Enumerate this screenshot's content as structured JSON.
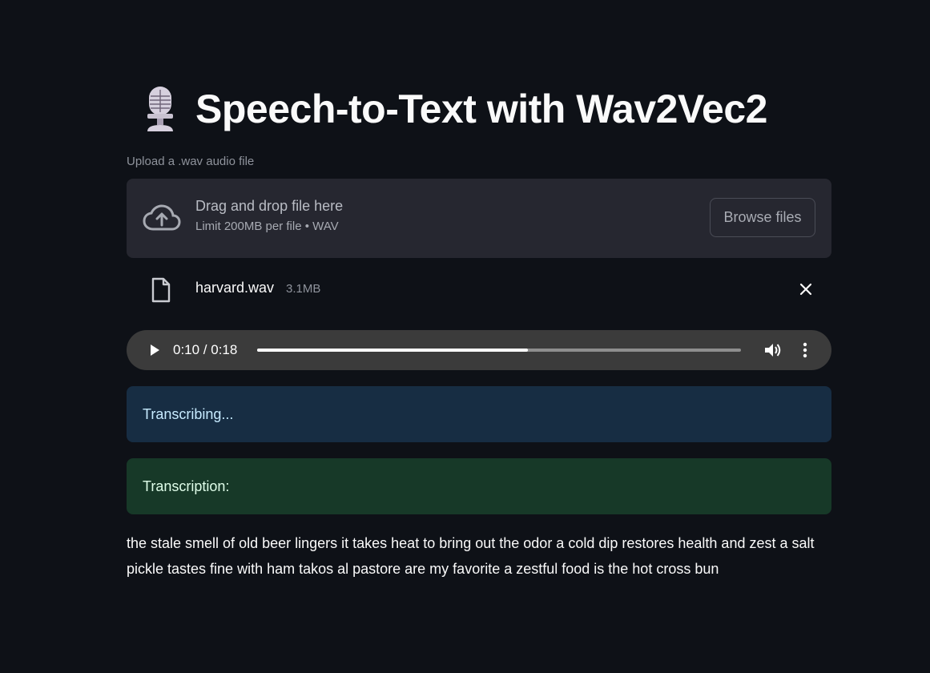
{
  "header": {
    "icon": "microphone-icon",
    "title": "Speech-to-Text with Wav2Vec2"
  },
  "uploader": {
    "label": "Upload a .wav audio file",
    "dropzone_text": "Drag and drop file here",
    "limit_text": "Limit 200MB per file • WAV",
    "browse_label": "Browse files",
    "icon": "cloud-upload-icon"
  },
  "file": {
    "name": "harvard.wav",
    "size": "3.1MB",
    "icon": "file-icon",
    "remove_icon": "close-icon"
  },
  "audio_player": {
    "time": "0:10 / 0:18",
    "progress": 0.56,
    "icons": [
      "play-icon",
      "volume-icon",
      "more-vertical-icon"
    ]
  },
  "status": {
    "info": "Transcribing...",
    "success": "Transcription:"
  },
  "transcription": "the stale smell of old beer lingers it takes heat to bring out the odor a cold dip restores health and zest a salt pickle tastes fine with ham takos al pastore are my favorite a zestful food is the hot cross bun",
  "colors": {
    "background": "#0e1117",
    "dropzone": "#262730",
    "info_bg": "#172d43",
    "info_text": "#c7ebff",
    "success_bg": "#173928",
    "success_text": "#dffde9",
    "player_bg": "#3b3b3b"
  }
}
